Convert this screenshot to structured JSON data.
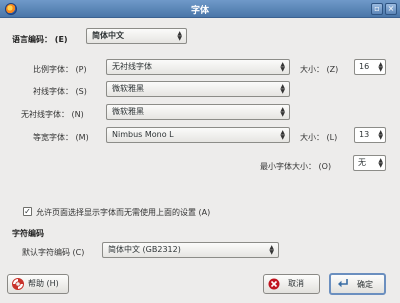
{
  "window": {
    "title": "字体"
  },
  "language": {
    "label": "语言编码：",
    "mnemonic": "(E)",
    "value": "简体中文"
  },
  "proportional": {
    "label": "比例字体：",
    "mnemonic": "(P)",
    "value": "无衬线字体",
    "size_label": "大小：",
    "size_mnemonic": "(Z)",
    "size_value": "16"
  },
  "serif": {
    "label": "衬线字体：",
    "mnemonic": "(S)",
    "value": "微软雅黑"
  },
  "sans_serif": {
    "label": "无衬线字体：",
    "mnemonic": "(N)",
    "value": "微软雅黑"
  },
  "monospace": {
    "label": "等宽字体：",
    "mnemonic": "(M)",
    "value": "Nimbus Mono L",
    "size_label": "大小：",
    "size_mnemonic": "(L)",
    "size_value": "13"
  },
  "min_size": {
    "label": "最小字体大小：",
    "mnemonic": "(O)",
    "value": "无"
  },
  "allow_pages": {
    "label": "允许页面选择显示字体而无需使用上面的设置",
    "mnemonic": "(A)",
    "checked": true,
    "check_glyph": "✓"
  },
  "encoding": {
    "section_title": "字符编码",
    "label": "默认字符编码",
    "mnemonic": "(C)",
    "value": "简体中文 (GB2312)"
  },
  "buttons": {
    "help": "帮助 (H)",
    "cancel": "取消",
    "ok": "确定"
  },
  "colors": {
    "titlebar": "#4a76a8",
    "window_bg": "#edeceb",
    "help_icon": "#c8322b",
    "cancel_icon": "#c0141f",
    "ok_icon": "#3a6ea5"
  }
}
